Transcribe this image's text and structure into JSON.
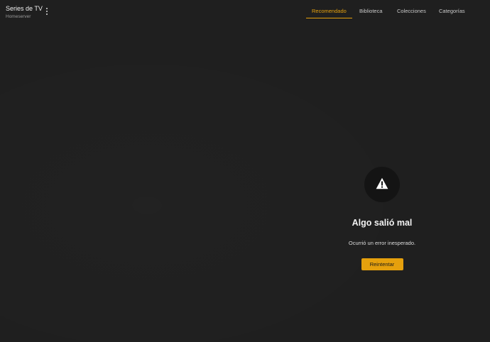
{
  "header": {
    "library_title": "Series de TV",
    "server_name": "Homeserver",
    "more_icon": "more-vertical-icon",
    "tabs": [
      {
        "label": "Recomendado",
        "active": true
      },
      {
        "label": "Biblioteca",
        "active": false
      },
      {
        "label": "Colecciones",
        "active": false
      },
      {
        "label": "Categorías",
        "active": false
      }
    ]
  },
  "error": {
    "icon": "warning-icon",
    "title": "Algo salió mal",
    "message": "Ocurrió un error inesperado.",
    "retry_label": "Reintentar"
  },
  "colors": {
    "background": "#1f1f1f",
    "accent": "#e5a00d",
    "icon_circle": "#141414"
  }
}
